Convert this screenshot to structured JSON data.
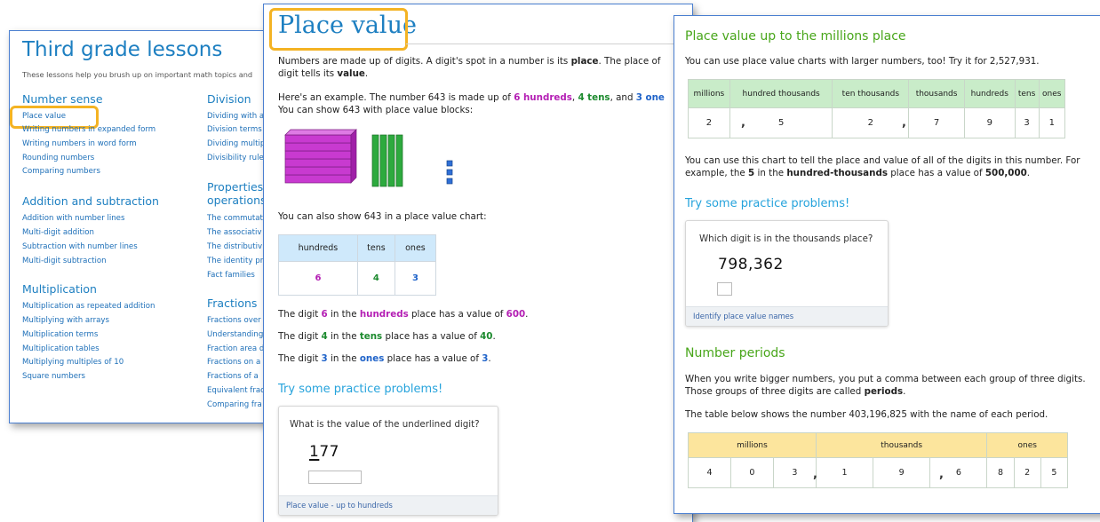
{
  "panel1": {
    "title": "Third grade lessons",
    "subtitle": "These lessons help you brush up on important math topics and",
    "col1": [
      {
        "heading": "Number sense",
        "items": [
          "Place value",
          "Writing numbers in expanded form",
          "Writing numbers in word form",
          "Rounding numbers",
          "Comparing numbers"
        ]
      },
      {
        "heading": "Addition and subtraction",
        "items": [
          "Addition with number lines",
          "Multi-digit addition",
          "Subtraction with number lines",
          "Multi-digit subtraction"
        ]
      },
      {
        "heading": "Multiplication",
        "items": [
          "Multiplication as repeated addition",
          "Multiplying with arrays",
          "Multiplication terms",
          "Multiplication tables",
          "Multiplying multiples of 10",
          "Square numbers"
        ]
      }
    ],
    "col2": [
      {
        "heading": "Division",
        "items": [
          "Dividing with a",
          "Division terms",
          "Dividing multip",
          "Divisibility rule"
        ]
      },
      {
        "heading_line1": "Properties",
        "heading_line2": "operations",
        "items": [
          "The commutat",
          "The associativ",
          "The distributiv",
          "The identity pr",
          "Fact families"
        ]
      },
      {
        "heading": "Fractions",
        "items": [
          "Fractions over",
          "Understanding",
          "Fraction area d",
          "Fractions on a",
          "Fractions of a",
          "Equivalent frac",
          "Comparing fra"
        ]
      }
    ]
  },
  "panel2": {
    "title": "Place value",
    "intro1_a": "Numbers are made up of digits. A digit's spot in a number is its ",
    "intro1_b": "place",
    "intro1_c": ". The place of",
    "intro2_a": "digit tells its ",
    "intro2_b": "value",
    "intro2_c": ".",
    "ex1_a": "Here's an example. The number 643 is made up of ",
    "ex1_b": "6 hundreds",
    "ex1_c": ", ",
    "ex1_d": "4 tens",
    "ex1_e": ", and ",
    "ex1_f": "3 one",
    "ex2": "You can show 643 with place value blocks:",
    "chart_intro": "You can also show 643 in a place value chart:",
    "chart_headers": [
      "hundreds",
      "tens",
      "ones"
    ],
    "chart_values": [
      "6",
      "4",
      "3"
    ],
    "d1": {
      "a": "The digit ",
      "digit": "6",
      "b": " in the ",
      "place": "hundreds",
      "c": " place has a value of ",
      "value": "600",
      "d": "."
    },
    "d2": {
      "a": "The digit ",
      "digit": "4",
      "b": " in the ",
      "place": "tens",
      "c": " place has a value of ",
      "value": "40",
      "d": "."
    },
    "d3": {
      "a": "The digit ",
      "digit": "3",
      "b": " in the ",
      "place": "ones",
      "c": " place has a value of ",
      "value": "3",
      "d": "."
    },
    "practice_heading": "Try some practice problems!",
    "card_question": "What is the value of the underlined digit?",
    "card_number_underlined": "1",
    "card_number_rest": "77",
    "card_footer": "Place value - up to hundreds"
  },
  "panel3": {
    "heading1": "Place value up to the millions place",
    "intro": "You can use place value charts with larger numbers, too! Try it for 2,527,931.",
    "table1_headers": [
      "millions",
      "hundred thousands",
      "ten thousands",
      "thousands",
      "hundreds",
      "tens",
      "ones"
    ],
    "table1_values": [
      "2",
      "5",
      "2",
      "7",
      "9",
      "3",
      "1"
    ],
    "comma": ",",
    "explain1": "You can use this chart to tell the place and value of all of the digits in this number. For",
    "explain2_a": "example, the ",
    "explain2_b": "5",
    "explain2_c": " in the ",
    "explain2_d": "hundred-thousands",
    "explain2_e": " place has a value of ",
    "explain2_f": "500,000",
    "explain2_g": ".",
    "practice_heading": "Try some practice problems!",
    "card_question": "Which digit is in the thousands place?",
    "card_number": "798,362",
    "card_footer": "Identify place value names",
    "heading2": "Number periods",
    "periods1": "When you write bigger numbers, you put a comma between each group of three digits.",
    "periods2_a": "Those groups of three digits are called ",
    "periods2_b": "periods",
    "periods2_c": ".",
    "periods3": "The table below shows the number 403,196,825 with the name of each period.",
    "table2_headers": [
      "millions",
      "thousands",
      "ones"
    ],
    "table2_values": [
      "4",
      "0",
      "3",
      "1",
      "9",
      "6",
      "8",
      "2",
      "5"
    ]
  },
  "colors": {
    "accent_blue": "#1d7fc1",
    "highlight": "#f4b323",
    "green_heading": "#48a61a",
    "table1_header": "#c9ecc9",
    "table2_header": "#fce59d",
    "chart_header": "#cfe9fb"
  }
}
